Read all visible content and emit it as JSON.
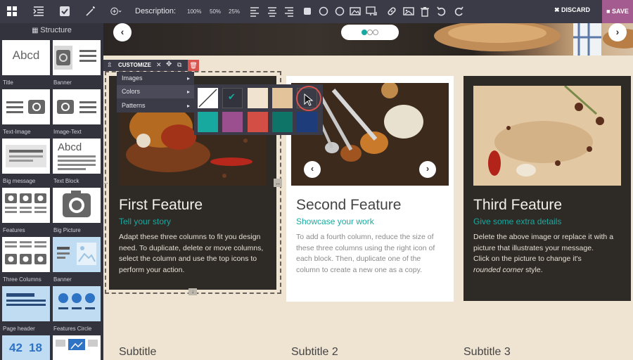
{
  "toolbar": {
    "description_label": "Description:",
    "zoom_options": [
      "100%",
      "50%",
      "25%"
    ],
    "discard_label": "DISCARD",
    "save_label": "SAVE"
  },
  "sidebar": {
    "title": "Structure",
    "snippets": [
      {
        "label": "Title"
      },
      {
        "label": "Banner"
      },
      {
        "label": "Text-Image"
      },
      {
        "label": "Image-Text"
      },
      {
        "label": "Big message"
      },
      {
        "label": "Text Block"
      },
      {
        "label": "Features"
      },
      {
        "label": "Big Picture"
      },
      {
        "label": "Three Columns"
      },
      {
        "label": "Banner"
      },
      {
        "label": "Page header"
      },
      {
        "label": "Features Circle"
      }
    ],
    "thumb_text_abcd": "Abcd",
    "thumb_numbers": [
      "42",
      "18"
    ]
  },
  "customize": {
    "label": "CUSTOMIZE",
    "menu": [
      {
        "label": "Images"
      },
      {
        "label": "Colors"
      },
      {
        "label": "Patterns"
      }
    ],
    "swatches_row1": [
      "none",
      "#33333e",
      "#f0e3d0",
      "#e2c39a",
      "#3b3b47"
    ],
    "swatches_row2": [
      "#17a99f",
      "#9b4f8e",
      "#d34e45",
      "#0e7468",
      "#1e3b7a"
    ]
  },
  "cards": [
    {
      "title": "First Feature",
      "subtitle": "Tell your story",
      "body": "Adapt these three columns to fit you design need. To duplicate, delete or move columns, select the column and use the top icons to perform your action."
    },
    {
      "title": "Second Feature",
      "subtitle": "Showcase your work",
      "body": "To add a fourth column, reduce the size of these three columns using the right icon of each block. Then, duplicate one of the column to create a new one as a copy."
    },
    {
      "title": "Third Feature",
      "subtitle": "Give some extra details",
      "body_line1": "Delete the above image or replace it with a picture that illustrates your message.",
      "body_line2": "Click on the picture to change it's",
      "body_line3_em": "rounded corner",
      "body_line3_rest": " style."
    }
  ],
  "subtitles": [
    "Subtitle",
    "Subtitle 2",
    "Subtitle 3"
  ]
}
